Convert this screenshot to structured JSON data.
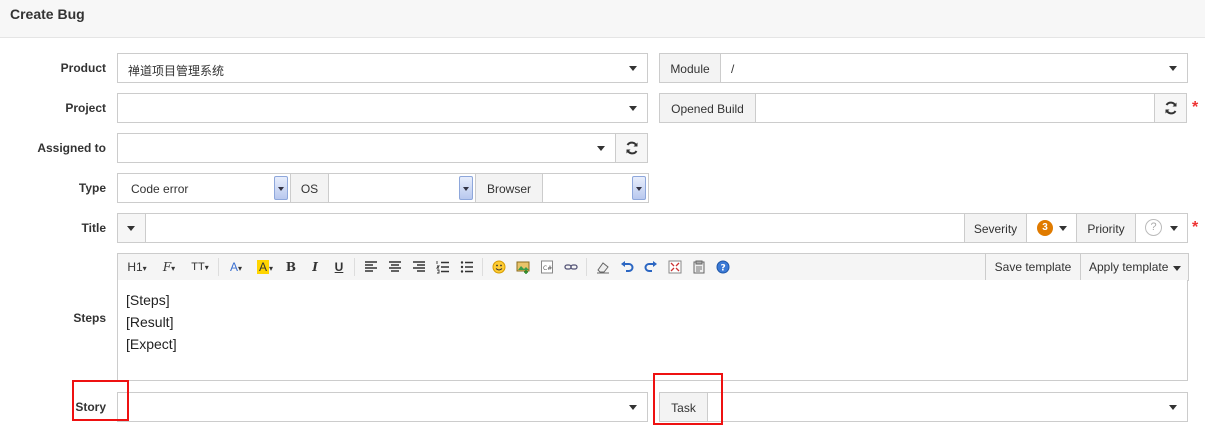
{
  "page": {
    "title": "Create Bug"
  },
  "form": {
    "product": {
      "label": "Product",
      "value": "禅道项目管理系统"
    },
    "module": {
      "label": "Module",
      "value": "/"
    },
    "project": {
      "label": "Project",
      "value": ""
    },
    "opened_build": {
      "label": "Opened Build",
      "value": "",
      "required": "*"
    },
    "assigned_to": {
      "label": "Assigned to",
      "value": ""
    },
    "type": {
      "label": "Type",
      "value": "Code error"
    },
    "os": {
      "label": "OS",
      "value": ""
    },
    "browser": {
      "label": "Browser",
      "value": ""
    },
    "title": {
      "label": "Title",
      "value": "",
      "required": "*"
    },
    "severity": {
      "label": "Severity",
      "value": "3"
    },
    "priority": {
      "label": "Priority",
      "value": "?"
    },
    "steps": {
      "label": "Steps",
      "lines": [
        "[Steps]",
        "[Result]",
        "[Expect]"
      ],
      "save_template": "Save template",
      "apply_template": "Apply template"
    },
    "story": {
      "label": "Story",
      "value": ""
    },
    "task": {
      "label": "Task",
      "value": ""
    }
  },
  "toolbar": {
    "heading": "H1",
    "font_family": "F",
    "font_size": "TT",
    "font_color": "A",
    "bg_color": "A",
    "bold": "B",
    "italic": "I",
    "underline": "U"
  },
  "colors": {
    "required": "#ee3333",
    "severity_badge": "#e07b00",
    "highlight": "#e11111"
  }
}
